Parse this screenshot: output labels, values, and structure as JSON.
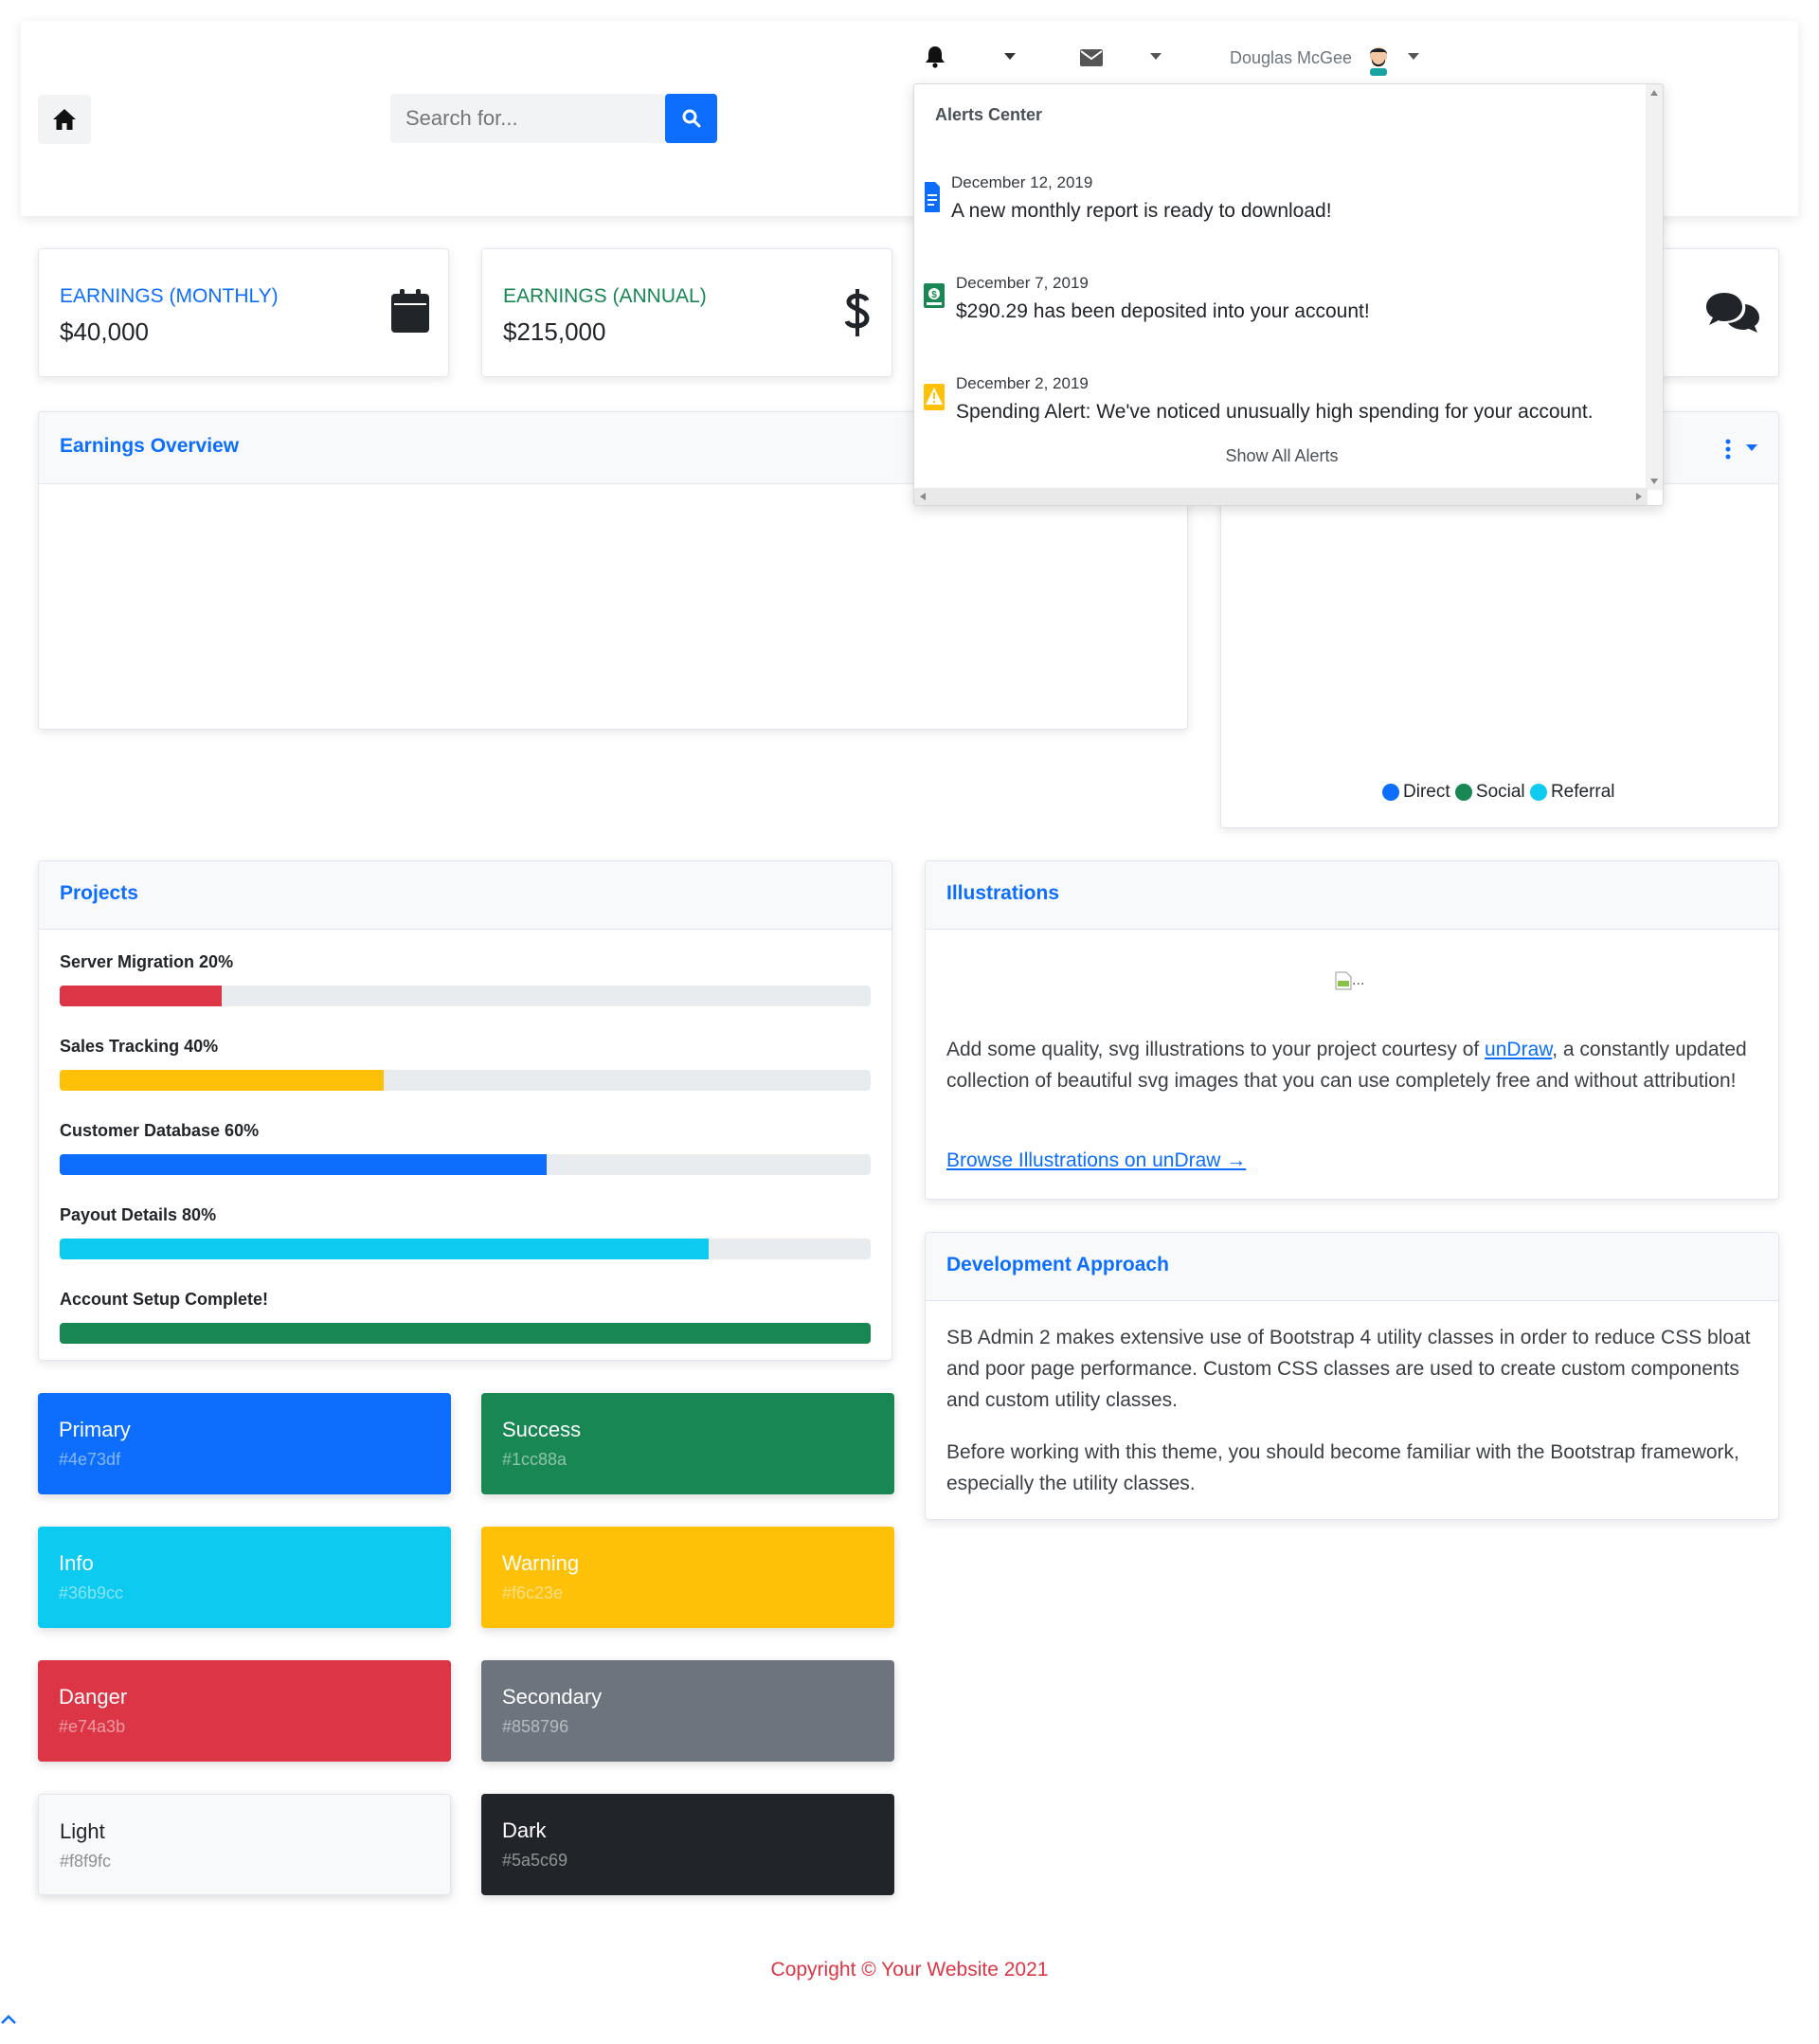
{
  "topbar": {
    "search_placeholder": "Search for...",
    "user_name": "Douglas McGee"
  },
  "alerts": {
    "header": "Alerts Center",
    "items": [
      {
        "date": "December 12, 2019",
        "text": "A new monthly report is ready to download!",
        "icon": "file-icon",
        "color": "#0d6efd"
      },
      {
        "date": "December 7, 2019",
        "text": "$290.29 has been deposited into your account!",
        "icon": "donate-icon",
        "color": "#198754"
      },
      {
        "date": "December 2, 2019",
        "text": "Spending Alert: We've noticed unusually high spending for your account.",
        "icon": "warning-icon",
        "color": "#ffc107"
      }
    ],
    "show_all": "Show All Alerts"
  },
  "stat_cards": [
    {
      "label": "EARNINGS (MONTHLY)",
      "value": "$40,000",
      "label_color": "#0d6efd",
      "icon": "calendar-icon"
    },
    {
      "label": "EARNINGS (ANNUAL)",
      "value": "$215,000",
      "label_color": "#198754",
      "icon": "dollar-icon"
    }
  ],
  "earnings_overview": {
    "title": "Earnings Overview"
  },
  "revenue_sources": {
    "legend": [
      {
        "label": "Direct",
        "color": "#0d6efd"
      },
      {
        "label": "Social",
        "color": "#198754"
      },
      {
        "label": "Referral",
        "color": "#0dcaf0"
      }
    ]
  },
  "projects": {
    "title": "Projects",
    "items": [
      {
        "label": "Server Migration 20%",
        "progress": 0.2,
        "color": "#dc3545"
      },
      {
        "label": "Sales Tracking 40%",
        "progress": 0.4,
        "color": "#ffc107"
      },
      {
        "label": "Customer Database 60%",
        "progress": 0.6,
        "color": "#0d6efd"
      },
      {
        "label": "Payout Details 80%",
        "progress": 0.8,
        "color": "#0dcaf0"
      },
      {
        "label": "Account Setup Complete!",
        "progress": 1.0,
        "color": "#198754"
      }
    ]
  },
  "color_cards": [
    {
      "name": "Primary",
      "hex": "#4e73df",
      "bg": "#0d6efd",
      "text": "#ffffff",
      "sub": "rgba(255,255,255,0.5)"
    },
    {
      "name": "Success",
      "hex": "#1cc88a",
      "bg": "#198754",
      "text": "#ffffff",
      "sub": "rgba(255,255,255,0.5)"
    },
    {
      "name": "Info",
      "hex": "#36b9cc",
      "bg": "#0dcaf0",
      "text": "#ffffff",
      "sub": "rgba(255,255,255,0.5)"
    },
    {
      "name": "Warning",
      "hex": "#f6c23e",
      "bg": "#ffc107",
      "text": "#ffffff",
      "sub": "rgba(255,255,255,0.5)"
    },
    {
      "name": "Danger",
      "hex": "#e74a3b",
      "bg": "#dc3545",
      "text": "#ffffff",
      "sub": "rgba(255,255,255,0.5)"
    },
    {
      "name": "Secondary",
      "hex": "#858796",
      "bg": "#6c757d",
      "text": "#ffffff",
      "sub": "rgba(255,255,255,0.5)"
    },
    {
      "name": "Light",
      "hex": "#f8f9fc",
      "bg": "#f8f9fa",
      "text": "#212529",
      "sub": "rgba(33,37,41,0.5)"
    },
    {
      "name": "Dark",
      "hex": "#5a5c69",
      "bg": "#212529",
      "text": "#ffffff",
      "sub": "rgba(255,255,255,0.5)"
    }
  ],
  "illustrations": {
    "title": "Illustrations",
    "img_alt": "...",
    "text_before": "Add some quality, svg illustrations to your project courtesy of ",
    "link_text": "unDraw",
    "text_after": ", a constantly updated collection of beautiful svg images that you can use completely free and without attribution!",
    "browse_link": "Browse Illustrations on unDraw →"
  },
  "development": {
    "title": "Development Approach",
    "p1": "SB Admin 2 makes extensive use of Bootstrap 4 utility classes in order to reduce CSS bloat and poor page performance. Custom CSS classes are used to create custom components and custom utility classes.",
    "p2": "Before working with this theme, you should become familiar with the Bootstrap framework, especially the utility classes."
  },
  "footer": {
    "copyright": "Copyright © Your Website 2021"
  }
}
